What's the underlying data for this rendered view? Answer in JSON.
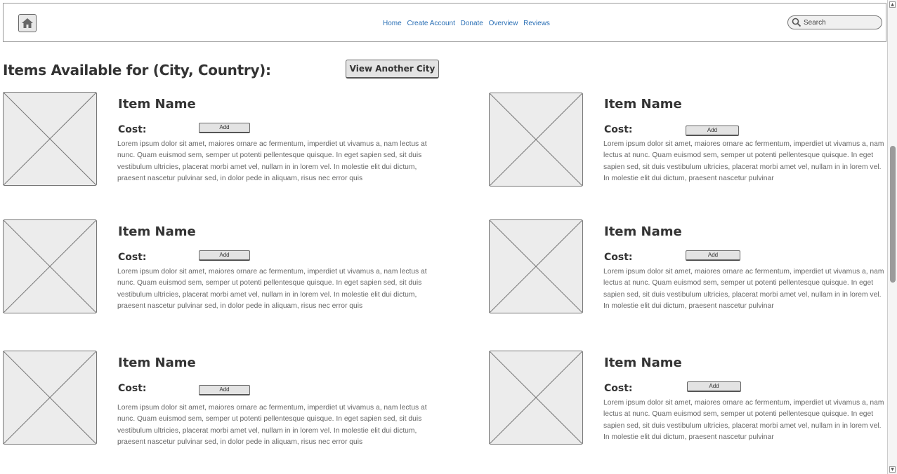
{
  "header": {
    "nav": [
      "Home",
      "Create Account",
      "Donate",
      "Overview",
      "Reviews"
    ],
    "search_placeholder": "Search"
  },
  "page": {
    "title": "Items Available for (City, Country):",
    "view_city_label": "View Another City"
  },
  "items": [
    {
      "name": "Item Name",
      "cost_label": "Cost:",
      "add_label": "Add",
      "description": "Lorem ipsum dolor sit amet, maiores ornare ac fermentum, imperdiet ut vivamus a, nam lectus at nunc. Quam euismod sem, semper ut potenti pellentesque quisque. In eget sapien sed, sit duis vestibulum ultricies, placerat morbi amet vel, nullam in in lorem vel. In molestie elit dui dictum, praesent nascetur pulvinar sed, in dolor pede in aliquam, risus nec error quis"
    },
    {
      "name": "Item Name",
      "cost_label": "Cost:",
      "add_label": "Add",
      "description": "Lorem ipsum dolor sit amet, maiores ornare ac fermentum, imperdiet ut vivamus a, nam lectus at nunc. Quam euismod sem, semper ut potenti pellentesque quisque. In eget sapien sed, sit duis vestibulum ultricies, placerat morbi amet vel, nullam in in lorem vel. In molestie elit dui dictum, praesent nascetur pulvinar"
    },
    {
      "name": "Item Name",
      "cost_label": "Cost:",
      "add_label": "Add",
      "description": "Lorem ipsum dolor sit amet, maiores ornare ac fermentum, imperdiet ut vivamus a, nam lectus at nunc. Quam euismod sem, semper ut potenti pellentesque quisque. In eget sapien sed, sit duis vestibulum ultricies, placerat morbi amet vel, nullam in in lorem vel. In molestie elit dui dictum, praesent nascetur pulvinar sed, in dolor pede in aliquam, risus nec error quis"
    },
    {
      "name": "Item Name",
      "cost_label": "Cost:",
      "add_label": "Add",
      "description": "Lorem ipsum dolor sit amet, maiores ornare ac fermentum, imperdiet ut vivamus a, nam lectus at nunc. Quam euismod sem, semper ut potenti pellentesque quisque. In eget sapien sed, sit duis vestibulum ultricies, placerat morbi amet vel, nullam in in lorem vel. In molestie elit dui dictum, praesent nascetur pulvinar"
    },
    {
      "name": "Item Name",
      "cost_label": "Cost:",
      "add_label": "Add",
      "description": "Lorem ipsum dolor sit amet, maiores ornare ac fermentum, imperdiet ut vivamus a, nam lectus at nunc. Quam euismod sem, semper ut potenti pellentesque quisque. In eget sapien sed, sit duis vestibulum ultricies, placerat morbi amet vel, nullam in in lorem vel. In molestie elit dui dictum, praesent nascetur pulvinar sed, in dolor pede in aliquam, risus nec error quis"
    },
    {
      "name": "Item Name",
      "cost_label": "Cost:",
      "add_label": "Add",
      "description": "Lorem ipsum dolor sit amet, maiores ornare ac fermentum, imperdiet ut vivamus a, nam lectus at nunc. Quam euismod sem, semper ut potenti pellentesque quisque. In eget sapien sed, sit duis vestibulum ultricies, placerat morbi amet vel, nullam in in lorem vel. In molestie elit dui dictum, praesent nascetur pulvinar"
    }
  ]
}
